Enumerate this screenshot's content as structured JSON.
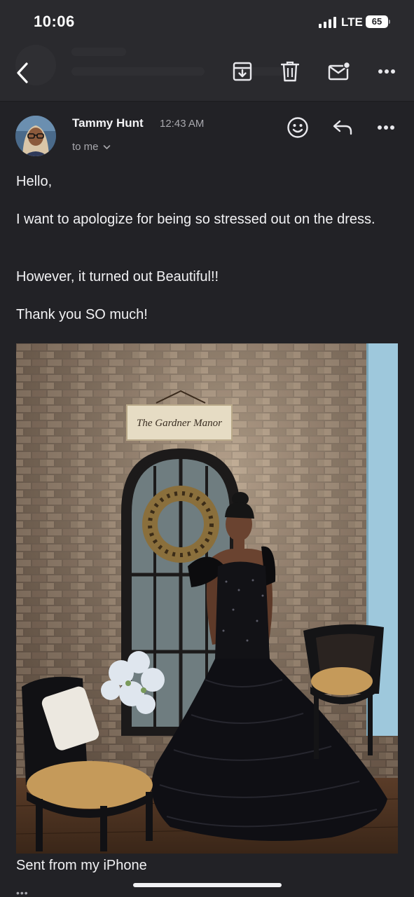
{
  "status_bar": {
    "time": "10:06",
    "network": "LTE",
    "battery": "65"
  },
  "toolbar": {
    "back_icon": "chevron-left-icon",
    "actions": [
      {
        "icon": "archive-icon"
      },
      {
        "icon": "trash-icon"
      },
      {
        "icon": "mark-unread-icon"
      },
      {
        "icon": "more-horizontal-icon"
      }
    ]
  },
  "email": {
    "sender_name": "Tammy Hunt",
    "time": "12:43 AM",
    "recipient": "to me",
    "recipient_icon": "chevron-down-icon",
    "header_actions": [
      {
        "icon": "emoji-icon"
      },
      {
        "icon": "reply-icon"
      },
      {
        "icon": "more-horizontal-icon"
      }
    ],
    "greeting": "Hello,",
    "paragraphs": [
      "I want to apologize for being so stressed out on the dress.",
      "However, it turned out Beautiful!!",
      "Thank you SO much!"
    ],
    "photo_sign_text": "The Gardner Manor",
    "signature": "Sent from my iPhone",
    "trimmed_indicator": "•••"
  },
  "colors": {
    "background": "#222226",
    "toolbar": "#2a2a2e",
    "text": "#f2f2f4",
    "secondary_text": "#a8a8ad"
  }
}
